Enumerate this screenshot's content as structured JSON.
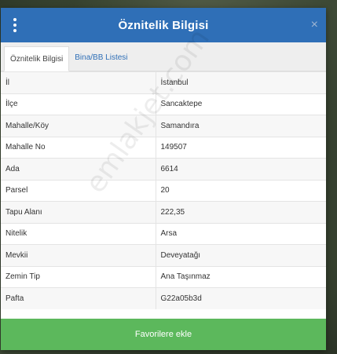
{
  "header": {
    "title": "Öznitelik Bilgisi",
    "close_glyph": "×",
    "accent": "#2f6fb7"
  },
  "tabs": [
    {
      "label": "Öznitelik Bilgisi",
      "active": true
    },
    {
      "label": "Bina/BB Listesi",
      "active": false
    }
  ],
  "attributes": [
    {
      "key": "İl",
      "value": "İstanbul"
    },
    {
      "key": "İlçe",
      "value": "Sancaktepe"
    },
    {
      "key": "Mahalle/Köy",
      "value": "Samandıra"
    },
    {
      "key": "Mahalle No",
      "value": "149507"
    },
    {
      "key": "Ada",
      "value": "6614"
    },
    {
      "key": "Parsel",
      "value": "20"
    },
    {
      "key": "Tapu Alanı",
      "value": "222,35"
    },
    {
      "key": "Nitelik",
      "value": "Arsa"
    },
    {
      "key": "Mevkii",
      "value": "Deveyatağı"
    },
    {
      "key": "Zemin Tip",
      "value": "Ana Taşınmaz"
    },
    {
      "key": "Pafta",
      "value": "G22a05b3d"
    }
  ],
  "footer": {
    "favorite_label": "Favorilere ekle",
    "button_color": "#5cb85c"
  },
  "watermark": "emlakjet.com"
}
